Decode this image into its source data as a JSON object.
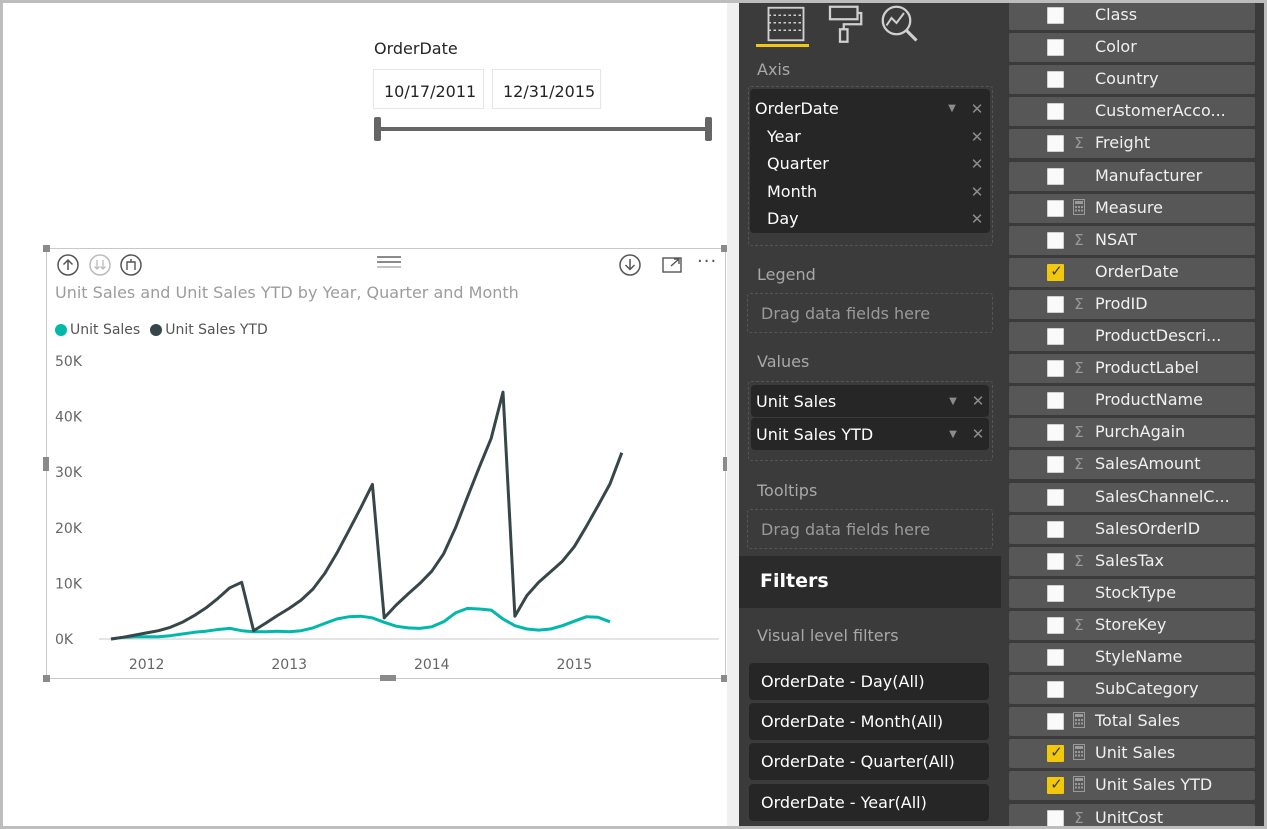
{
  "slicer": {
    "title": "OrderDate",
    "start_date": "10/17/2011",
    "end_date": "12/31/2015"
  },
  "visual": {
    "title": "Unit Sales and Unit Sales YTD by Year, Quarter and Month",
    "header_icons": [
      "drill-up-icon",
      "drill-down-all-icon",
      "expand-next-level-icon",
      "drill-mode-icon",
      "focus-mode-icon",
      "more-options-icon"
    ]
  },
  "chart_data": {
    "type": "line",
    "title": "Unit Sales and Unit Sales YTD by Year, Quarter and Month",
    "xlabel": "",
    "ylabel": "",
    "x_tick_labels": [
      "2012",
      "2013",
      "2014",
      "2015"
    ],
    "y_tick_labels": [
      "50K",
      "40K",
      "30K",
      "20K",
      "10K",
      "0K"
    ],
    "ylim": [
      0,
      50000
    ],
    "legend_position": "top-left",
    "grid": false,
    "x_index": [
      0,
      1,
      2,
      3,
      4,
      5,
      6,
      7,
      8,
      9,
      10,
      11,
      12,
      13,
      14,
      15,
      16,
      17,
      18,
      19,
      20,
      21,
      22,
      23,
      24,
      25,
      26,
      27,
      28,
      29,
      30,
      31,
      32,
      33,
      34,
      35,
      36,
      37,
      38,
      39,
      40,
      41,
      42,
      43,
      44,
      45,
      46,
      47,
      48,
      49
    ],
    "series": [
      {
        "name": "Unit Sales",
        "color": "#01b8aa",
        "values": [
          0,
          300,
          400,
          400,
          400,
          600,
          900,
          1200,
          1400,
          1700,
          1900,
          1500,
          1300,
          1300,
          1400,
          1300,
          1500,
          2000,
          2800,
          3600,
          4000,
          4100,
          3800,
          3000,
          2300,
          2000,
          1900,
          2200,
          3100,
          4700,
          5500,
          5400,
          5200,
          3600,
          2400,
          1800,
          1600,
          1800,
          2400,
          3200,
          4000,
          3900,
          3100
        ]
      },
      {
        "name": "Unit Sales YTD",
        "color": "#374649",
        "values": [
          0,
          300,
          700,
          1100,
          1500,
          2100,
          3000,
          4200,
          5600,
          7300,
          9200,
          10200,
          1500,
          2800,
          4200,
          5500,
          7000,
          9000,
          11800,
          15400,
          19400,
          23500,
          27800,
          3800,
          6100,
          8100,
          10000,
          12200,
          15300,
          20000,
          25500,
          30900,
          36100,
          44400,
          4100,
          7800,
          10200,
          12100,
          14000,
          16600,
          20200,
          24000,
          27900,
          33500
        ]
      }
    ]
  },
  "tabs": {
    "fields_well_icon": "fields-well-icon",
    "format_icon": "paint-roller-icon",
    "analytics_icon": "analytics-icon"
  },
  "wells": {
    "axis_label": "Axis",
    "axis_items": [
      "OrderDate",
      "Year",
      "Quarter",
      "Month",
      "Day"
    ],
    "legend_label": "Legend",
    "legend_placeholder": "Drag data fields here",
    "values_label": "Values",
    "values_items": [
      "Unit Sales",
      "Unit Sales YTD"
    ],
    "tooltips_label": "Tooltips",
    "tooltips_placeholder": "Drag data fields here"
  },
  "filters": {
    "title": "Filters",
    "section_label": "Visual level filters",
    "items": [
      "OrderDate - Day(All)",
      "OrderDate - Month(All)",
      "OrderDate - Quarter(All)",
      "OrderDate - Year(All)"
    ]
  },
  "fields": [
    {
      "name": "Class",
      "checked": false,
      "type": ""
    },
    {
      "name": "Color",
      "checked": false,
      "type": ""
    },
    {
      "name": "Country",
      "checked": false,
      "type": ""
    },
    {
      "name": "CustomerAcco...",
      "checked": false,
      "type": ""
    },
    {
      "name": "Freight",
      "checked": false,
      "type": "sigma-icon"
    },
    {
      "name": "Manufacturer",
      "checked": false,
      "type": ""
    },
    {
      "name": "Measure",
      "checked": false,
      "type": "calculator-icon"
    },
    {
      "name": "NSAT",
      "checked": false,
      "type": "sigma-icon"
    },
    {
      "name": "OrderDate",
      "checked": true,
      "type": ""
    },
    {
      "name": "ProdID",
      "checked": false,
      "type": "sigma-icon"
    },
    {
      "name": "ProductDescri...",
      "checked": false,
      "type": ""
    },
    {
      "name": "ProductLabel",
      "checked": false,
      "type": "sigma-icon"
    },
    {
      "name": "ProductName",
      "checked": false,
      "type": ""
    },
    {
      "name": "PurchAgain",
      "checked": false,
      "type": "sigma-icon"
    },
    {
      "name": "SalesAmount",
      "checked": false,
      "type": "sigma-icon"
    },
    {
      "name": "SalesChannelC...",
      "checked": false,
      "type": ""
    },
    {
      "name": "SalesOrderID",
      "checked": false,
      "type": ""
    },
    {
      "name": "SalesTax",
      "checked": false,
      "type": "sigma-icon"
    },
    {
      "name": "StockType",
      "checked": false,
      "type": ""
    },
    {
      "name": "StoreKey",
      "checked": false,
      "type": "sigma-icon"
    },
    {
      "name": "StyleName",
      "checked": false,
      "type": ""
    },
    {
      "name": "SubCategory",
      "checked": false,
      "type": ""
    },
    {
      "name": "Total Sales",
      "checked": false,
      "type": "calculator-icon"
    },
    {
      "name": "Unit Sales",
      "checked": true,
      "type": "calculator-icon"
    },
    {
      "name": "Unit Sales YTD",
      "checked": true,
      "type": "calculator-icon"
    },
    {
      "name": "UnitCost",
      "checked": false,
      "type": "sigma-icon"
    }
  ]
}
